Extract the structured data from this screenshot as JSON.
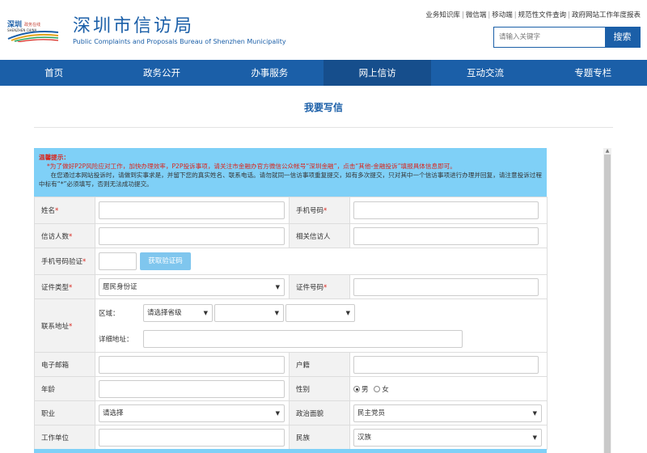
{
  "header": {
    "logo_badge_text": "深圳 政务在线",
    "logo_badge_sub": "SHENZHEN CHINA",
    "title": "深圳市信访局",
    "subtitle": "Public Complaints and Proposals Bureau of Shenzhen Municipality",
    "top_links": [
      "业务知识库",
      "微信端",
      "移动端",
      "规范性文件查询",
      "政府网站工作年度报表"
    ],
    "search_placeholder": "请输入关键字",
    "search_button": "搜索"
  },
  "nav": {
    "items": [
      "首页",
      "政务公开",
      "办事服务",
      "网上信访",
      "互动交流",
      "专题专栏"
    ],
    "active_index": 3
  },
  "page": {
    "title": "我要写信"
  },
  "notice": {
    "title": "温馨提示：",
    "line_red": "*为了做好P2P风险应对工作，加快办理效率，P2P投诉事项，请关注市金融办官方微信公众帐号“深圳金融”，点击“其他-金融投诉”填报具体信息即可。",
    "line_normal": "在您通过本网站投诉时，请做到实事求是，并留下您的真实姓名、联系电话。请勿就同一信访事项重复提交，如有多次提交，只对其中一个信访事项进行办理并回复，请注意投诉过程中标有“*”必须填写，否则无法成功提交。"
  },
  "form": {
    "name_label": "姓名",
    "phone_label": "手机号码",
    "visitors_label": "信访人数",
    "related_label": "相关信访人",
    "code_label": "手机号码验证",
    "code_button": "获取验证码",
    "idtype_label": "证件类型",
    "idtype_value": "居民身份证",
    "idno_label": "证件号码",
    "address_label": "联系地址",
    "region_label": "区域：",
    "province_value": "请选择省级",
    "detail_label": "详细地址：",
    "email_label": "电子邮箱",
    "hukou_label": "户籍",
    "age_label": "年龄",
    "gender_label": "性别",
    "gender_male": "男",
    "gender_female": "女",
    "job_label": "职业",
    "job_value": "请选择",
    "political_label": "政治面貌",
    "political_value": "民主党员",
    "work_label": "工作单位",
    "ethnic_label": "民族",
    "ethnic_value": "汉族",
    "required_mark": "*"
  },
  "colors": {
    "brand": "#1b5fa8",
    "notice_bg": "#7fd0f7",
    "required": "#d9251c"
  }
}
